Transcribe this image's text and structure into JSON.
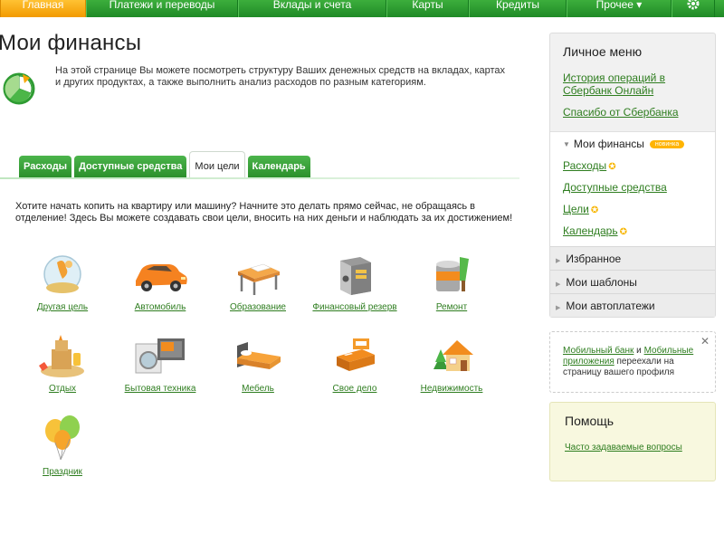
{
  "nav": {
    "items": [
      "Главная",
      "Платежи и переводы",
      "Вклады и счета",
      "Карты",
      "Кредиты",
      "Прочее ▾"
    ]
  },
  "header": {
    "title": "Мои финансы",
    "intro": "На этой странице Вы можете посмотреть структуру Ваших денежных средств на вкладах, картах и других продуктах, а также выполнить анализ расходов по разным категориям."
  },
  "tabs": [
    {
      "label": "Расходы"
    },
    {
      "label": "Доступные средства"
    },
    {
      "label": "Мои цели"
    },
    {
      "label": "Календарь"
    }
  ],
  "goals": {
    "intro": "Хотите начать копить на квартиру или машину? Начните это делать прямо сейчас, не обращаясь в отделение! Здесь Вы можете создавать свои цели, вносить на них деньги и наблюдать за их достижением!",
    "items": [
      {
        "label": "Другая цель",
        "icon": "globe-icon"
      },
      {
        "label": "Автомобиль",
        "icon": "car-icon"
      },
      {
        "label": "Образование",
        "icon": "desk-icon"
      },
      {
        "label": "Финансовый резерв",
        "icon": "safe-icon"
      },
      {
        "label": "Ремонт",
        "icon": "paint-bucket-icon"
      },
      {
        "label": "Отдых",
        "icon": "sandcastle-icon"
      },
      {
        "label": "Бытовая техника",
        "icon": "appliances-icon"
      },
      {
        "label": "Мебель",
        "icon": "bed-icon"
      },
      {
        "label": "Свое дело",
        "icon": "cash-register-icon"
      },
      {
        "label": "Недвижимость",
        "icon": "house-icon"
      },
      {
        "label": "Праздник",
        "icon": "balloons-icon"
      }
    ]
  },
  "sidebar": {
    "title": "Личное меню",
    "links": [
      "История операций в Сбербанк Онлайн",
      "Спасибо от Сбербанка"
    ],
    "finance": {
      "title": "Мои финансы",
      "badge": "новинка",
      "links": [
        "Расходы",
        "Доступные средства",
        "Цели",
        "Календарь"
      ]
    },
    "rows": [
      "Избранное",
      "Мои шаблоны",
      "Мои автоплатежи"
    ]
  },
  "notice": {
    "link1": "Мобильный банк",
    "and": " и ",
    "link2": "Мобильные приложения",
    "rest": " переехали на страницу вашего профиля"
  },
  "help": {
    "title": "Помощь",
    "link": "Часто задаваемые вопросы"
  },
  "colors": {
    "brand_green": "#2e9b32",
    "active_orange": "#f7a600",
    "link_green": "#2e7d1f"
  }
}
